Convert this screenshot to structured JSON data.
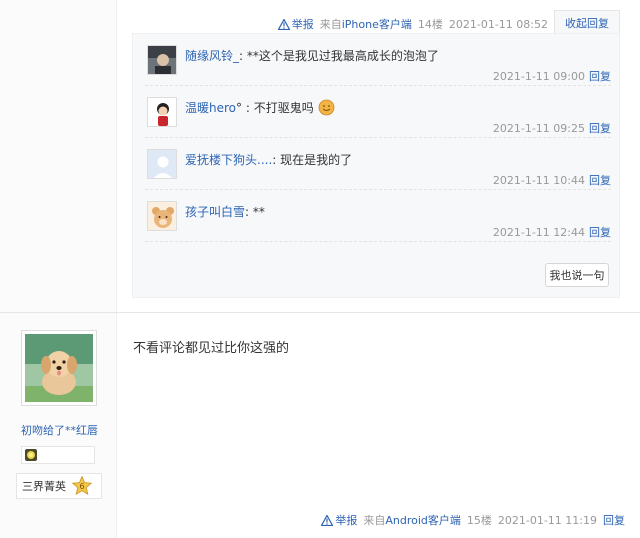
{
  "post1": {
    "report_label": "举报",
    "client_prefix": "来自",
    "client_name": "iPhone客户端",
    "floor": "14楼",
    "timestamp": "2021-01-11 08:52",
    "collapse_label": "收起回复",
    "replies": [
      {
        "user": "随缘风铃_",
        "sep": ": ",
        "text": "**这个是我见过我最高成长的泡泡了",
        "time": "2021-1-11 09:00",
        "reply_label": "回复"
      },
      {
        "user": "温暖hero",
        "sep": "° : ",
        "text": "不打驱鬼吗",
        "time": "2021-1-11 09:25",
        "reply_label": "回复"
      },
      {
        "user": "爱抚楼下狗头....",
        "sep": ": ",
        "text": "现在是我的了",
        "time": "2021-1-11 10:44",
        "reply_label": "回复"
      },
      {
        "user": "孩子叫白雪",
        "sep": ": ",
        "text": "**",
        "time": "2021-1-11 12:44",
        "reply_label": "回复"
      }
    ],
    "say_label": "我也说一句"
  },
  "post2": {
    "username": "初吻给了**红唇",
    "rank_title": "三界菁英",
    "rank_level": "6",
    "content": "不看评论都见过比你这强的",
    "report_label": "举报",
    "client_prefix": "来自",
    "client_name": "Android客户端",
    "floor": "15楼",
    "timestamp": "2021-01-11 11:19",
    "reply_label": "回复"
  },
  "colors": {
    "link": "#2d64b3",
    "meta": "#999999",
    "reply_bg": "#f7f8fa"
  }
}
